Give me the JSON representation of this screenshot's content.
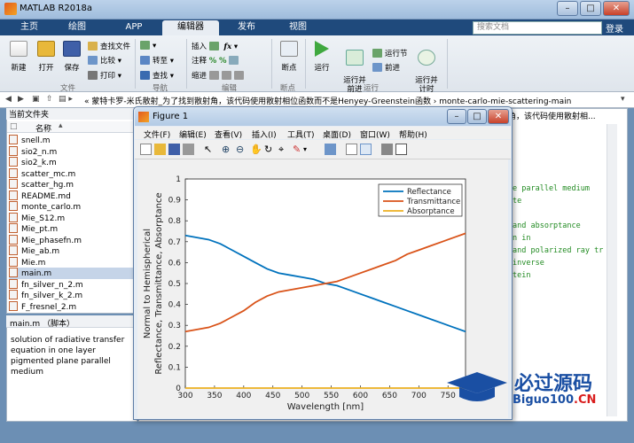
{
  "window": {
    "title": "MATLAB R2018a"
  },
  "tabs": [
    {
      "label": "主页"
    },
    {
      "label": "绘图"
    },
    {
      "label": "APP"
    },
    {
      "label": "编辑器"
    },
    {
      "label": "发布"
    },
    {
      "label": "视图"
    }
  ],
  "search": {
    "placeholder": "搜索文档"
  },
  "signin": "登录",
  "toolstrip": {
    "new_label": "新建",
    "open_label": "打开",
    "save_label": "保存",
    "find_files": "查找文件",
    "compare": "比较",
    "print": "打印",
    "file_group": "文件",
    "goto": "转至",
    "find": "查找",
    "nav_group": "导航",
    "insert": "插入",
    "comment": "注释",
    "indent": "缩进",
    "edit_group": "编辑",
    "breakpoints": "断点",
    "bp_group": "断点",
    "run": "运行",
    "run_advance": "运行并\n前进",
    "run_section": "运行节",
    "advance": "前进",
    "run_time": "运行并\n计时",
    "run_group": "运行",
    "fx": "fx"
  },
  "address": {
    "path": "« 蒙特卡罗-米氏散射_为了找到散射角，该代码使用散射相位函数而不是Henyey-Greenstein函数  ›  monte-carlo-mie-scattering-main"
  },
  "current_folder": {
    "header": "当前文件夹",
    "column": "名称",
    "files": [
      "snell.m",
      "sio2_n.m",
      "sio2_k.m",
      "scatter_mc.m",
      "scatter_hg.m",
      "README.md",
      "monte_carlo.m",
      "Mie_S12.m",
      "Mie_pt.m",
      "Mie_phasefn.m",
      "Mie_ab.m",
      "Mie.m",
      "main.m",
      "fn_silver_n_2.m",
      "fn_silver_k_2.m",
      "F_fresnel_2.m"
    ],
    "selected_index": 12
  },
  "details": {
    "header": "main.m （脚本）",
    "text": "solution of radiative transfer equation in one layer pigmented plane parallel medium"
  },
  "editor": {
    "tab_text": "角，该代码使用散射相...",
    "code_lines": [
      "e parallel medium",
      "te",
      "",
      "and absorptance",
      "n in",
      "and polarized ray tr",
      "inverse",
      "tein"
    ]
  },
  "figure": {
    "title": "Figure 1",
    "menu": [
      "文件(F)",
      "编辑(E)",
      "查看(V)",
      "插入(I)",
      "工具(T)",
      "桌面(D)",
      "窗口(W)",
      "帮助(H)"
    ]
  },
  "chart_data": {
    "type": "line",
    "xlabel": "Wavelength [nm]",
    "ylabel": "Normal to Hemispherical\nReflectance, Transmittance, Absorptance",
    "xlim": [
      300,
      780
    ],
    "ylim": [
      0,
      1
    ],
    "xticks": [
      300,
      350,
      400,
      450,
      500,
      550,
      600,
      650,
      700,
      750
    ],
    "yticks": [
      0,
      0.1,
      0.2,
      0.3,
      0.4,
      0.5,
      0.6,
      0.7,
      0.8,
      0.9,
      1
    ],
    "legend_position": "top-right",
    "x": [
      300,
      320,
      340,
      360,
      380,
      400,
      420,
      440,
      460,
      480,
      500,
      520,
      540,
      560,
      580,
      600,
      620,
      640,
      660,
      680,
      700,
      720,
      740,
      760,
      780
    ],
    "series": [
      {
        "name": "Reflectance",
        "color": "#0072bd",
        "values": [
          0.73,
          0.72,
          0.71,
          0.69,
          0.66,
          0.63,
          0.6,
          0.57,
          0.55,
          0.54,
          0.53,
          0.52,
          0.5,
          0.49,
          0.47,
          0.45,
          0.43,
          0.41,
          0.39,
          0.37,
          0.35,
          0.33,
          0.31,
          0.29,
          0.27
        ]
      },
      {
        "name": "Transmittance",
        "color": "#d95319",
        "values": [
          0.27,
          0.28,
          0.29,
          0.31,
          0.34,
          0.37,
          0.41,
          0.44,
          0.46,
          0.47,
          0.48,
          0.49,
          0.5,
          0.51,
          0.53,
          0.55,
          0.57,
          0.59,
          0.61,
          0.64,
          0.66,
          0.68,
          0.7,
          0.72,
          0.74
        ]
      },
      {
        "name": "Absorptance",
        "color": "#edb120",
        "values": [
          0,
          0,
          0,
          0,
          0,
          0,
          0,
          0,
          0,
          0,
          0,
          0,
          0,
          0,
          0,
          0,
          0,
          0,
          0,
          0,
          0,
          0,
          0,
          0,
          0
        ]
      }
    ]
  },
  "watermark": {
    "main": "必过源码",
    "sub": "Biguo100",
    "sub_cn": ".CN"
  }
}
